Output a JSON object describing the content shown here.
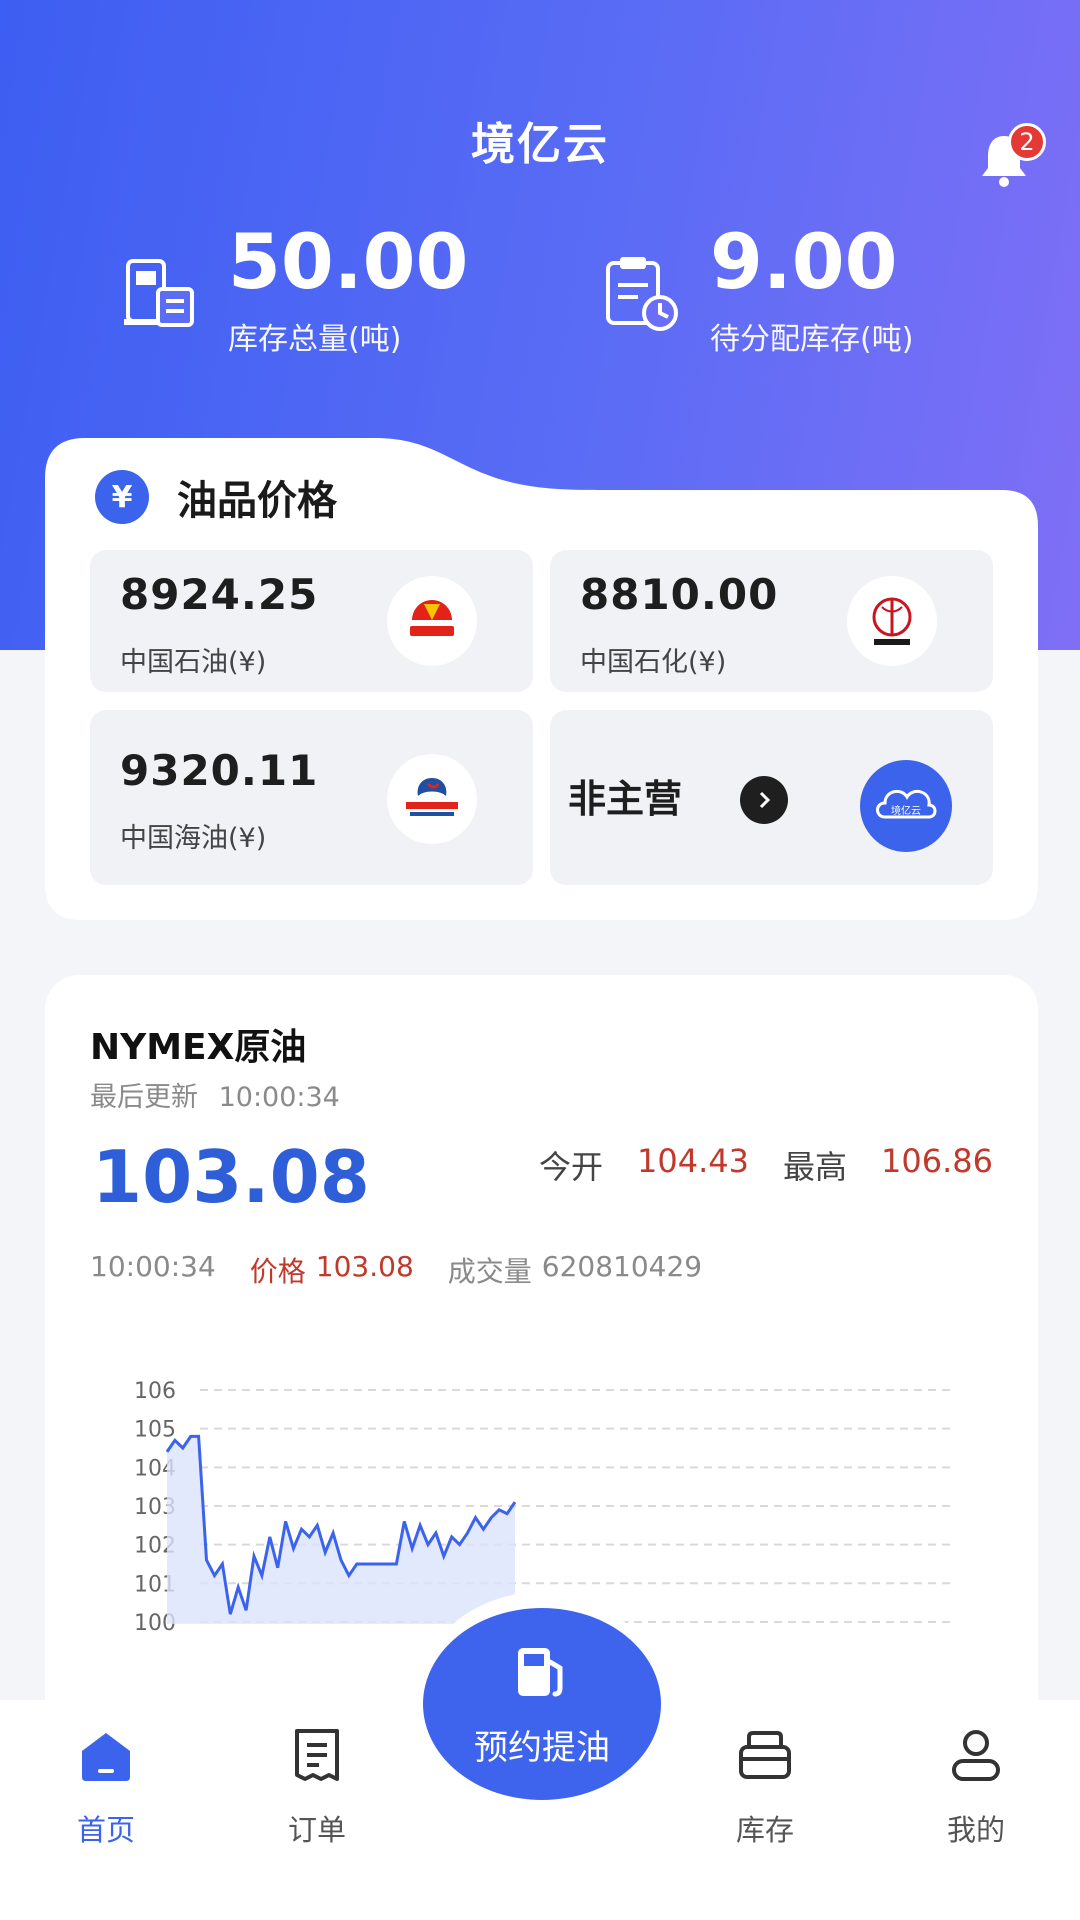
{
  "header": {
    "title": "境亿云",
    "notifications_count": "2",
    "stats": [
      {
        "value": "50.00",
        "label": "库存总量(吨)",
        "icon": "fuel-pump-doc-icon"
      },
      {
        "value": "9.00",
        "label": "待分配库存(吨)",
        "icon": "clipboard-clock-icon"
      }
    ]
  },
  "oil_prices": {
    "title": "油品价格",
    "yen_symbol": "¥",
    "tiles": [
      {
        "price": "8924.25",
        "name": "中国石油(¥)",
        "logo": "petrochina-logo"
      },
      {
        "price": "8810.00",
        "name": "中国石化(¥)",
        "logo": "sinopec-logo"
      },
      {
        "price": "9320.11",
        "name": "中国海油(¥)",
        "logo": "cnooc-logo"
      }
    ],
    "non_main": {
      "label": "非主营",
      "logo_text": "境亿云"
    }
  },
  "market": {
    "title": "NYMEX原油",
    "updated_label": "最后更新",
    "updated_time": "10:00:34",
    "price": "103.08",
    "open_label": "今开",
    "open_value": "104.43",
    "high_label": "最高",
    "high_value": "106.86",
    "tick_time": "10:00:34",
    "tick_price_label": "价格",
    "tick_price": "103.08",
    "volume_label": "成交量",
    "volume": "620810429"
  },
  "chart_data": {
    "type": "area",
    "ylim": [
      99,
      106
    ],
    "yticks": [
      "106",
      "105",
      "104",
      "103",
      "102",
      "101",
      "100"
    ],
    "series": [
      {
        "values": [
          104.4,
          104.7,
          104.5,
          104.8,
          104.8,
          101.6,
          101.2,
          101.5,
          100.2,
          100.9,
          100.3,
          101.7,
          101.2,
          102.2,
          101.4,
          102.6,
          101.9,
          102.4,
          102.2,
          102.5,
          101.8,
          102.3,
          101.6,
          101.2,
          101.5,
          101.5,
          101.5,
          101.5,
          101.5,
          101.5,
          102.6,
          101.9,
          102.5,
          102.0,
          102.3,
          101.7,
          102.2,
          102.0,
          102.3,
          102.7,
          102.4,
          102.7,
          102.9,
          102.8,
          103.1
        ]
      }
    ],
    "colors": {
      "line": "#3b63ec",
      "fill": "#dbe4fb"
    }
  },
  "nav": {
    "items": [
      {
        "label": "首页",
        "icon": "home-icon",
        "active": true
      },
      {
        "label": "订单",
        "icon": "order-list-icon",
        "active": false
      },
      {
        "label": "库存",
        "icon": "inventory-icon",
        "active": false
      },
      {
        "label": "我的",
        "icon": "profile-icon",
        "active": false
      }
    ],
    "fab_label": "预约提油"
  },
  "colors": {
    "primary": "#3b63ec",
    "accent_red": "#c0392b",
    "gradient_end": "#7f6ff6"
  }
}
